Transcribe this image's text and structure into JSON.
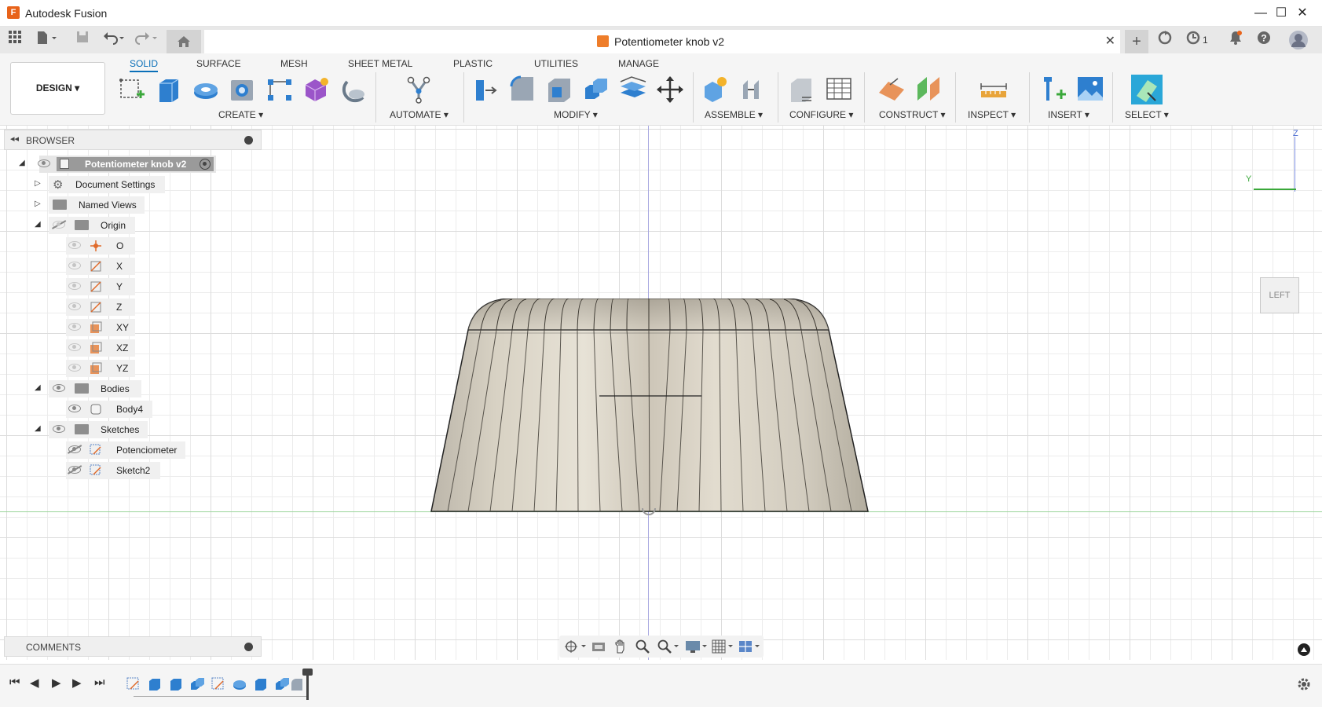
{
  "app": {
    "title": "Autodesk Fusion",
    "logo_letter": "F"
  },
  "window_controls": {
    "minimize": "—",
    "maximize": "☐",
    "close": "✕"
  },
  "document_tab": {
    "title": "Potentiometer knob v2",
    "close": "✕"
  },
  "tabstrip": {
    "new_tab": "+",
    "job_count": "1"
  },
  "ribbon": {
    "workspace": "DESIGN ▾",
    "tabs": [
      "SOLID",
      "SURFACE",
      "MESH",
      "SHEET METAL",
      "PLASTIC",
      "UTILITIES",
      "MANAGE"
    ],
    "active_tab": "SOLID",
    "groups": [
      "CREATE ▾",
      "AUTOMATE ▾",
      "MODIFY ▾",
      "ASSEMBLE ▾",
      "CONFIGURE ▾",
      "CONSTRUCT ▾",
      "INSPECT ▾",
      "INSERT ▾",
      "SELECT ▾"
    ]
  },
  "browser": {
    "title": "BROWSER",
    "root": "Potentiometer knob v2",
    "document_settings": "Document Settings",
    "named_views": "Named Views",
    "origin": {
      "label": "Origin",
      "items": [
        "O",
        "X",
        "Y",
        "Z",
        "XY",
        "XZ",
        "YZ"
      ]
    },
    "bodies": {
      "label": "Bodies",
      "items": [
        "Body4"
      ]
    },
    "sketches": {
      "label": "Sketches",
      "items": [
        "Potenciometer",
        "Sketch2"
      ]
    }
  },
  "comments": {
    "title": "COMMENTS"
  },
  "viewcube": {
    "face": "LEFT",
    "axis_z": "Z",
    "axis_y": "Y"
  },
  "colors": {
    "accent": "#0a6fb8",
    "brand": "#e8631a",
    "x_axis": "#9ad49a",
    "z_axis": "#a8a8e0"
  }
}
